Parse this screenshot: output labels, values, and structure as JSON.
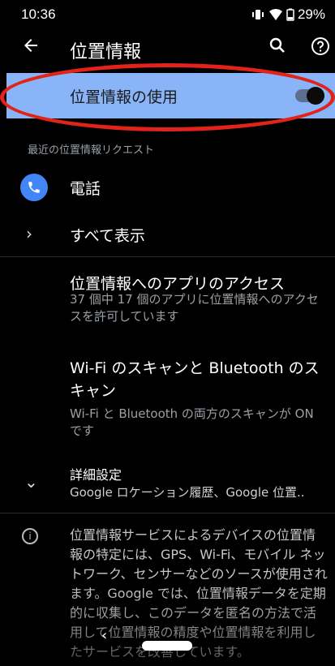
{
  "status_bar": {
    "time": "10:36",
    "battery": "29%"
  },
  "app_bar": {
    "title": "位置情報"
  },
  "location_toggle": {
    "label": "位置情報の使用",
    "state": "on",
    "highlight_color": "#8ab4f8"
  },
  "recent_requests": {
    "header": "最近の位置情報リクエスト",
    "items": [
      {
        "label": "電話",
        "icon": "phone-icon"
      }
    ],
    "see_all_label": "すべて表示"
  },
  "app_access": {
    "title": "位置情報へのアプリのアクセス",
    "subtitle": "37 個中 17 個のアプリに位置情報へのアクセスを許可しています"
  },
  "scanning": {
    "title": "Wi-Fi のスキャンと Bluetooth のスキャン",
    "subtitle": "Wi-Fi と Bluetooth の両方のスキャンが ON です"
  },
  "advanced": {
    "title": "詳細設定",
    "subtitle": "Google ロケーション履歴、Google 位置.."
  },
  "info": {
    "text": "位置情報サービスによるデバイスの位置情報の特定には、GPS、Wi-Fi、モバイル ネットワーク、センサーなどのソースが使用されます。Google では、位置情報データを定期的に収集し、このデータを匿名の方法で活用して位置情報の精度や位置情報を利用したサービスを改善しています。"
  },
  "nav_bar": {
    "back_icon": "chevron-left-icon",
    "home_icon": "home-pill-icon"
  }
}
